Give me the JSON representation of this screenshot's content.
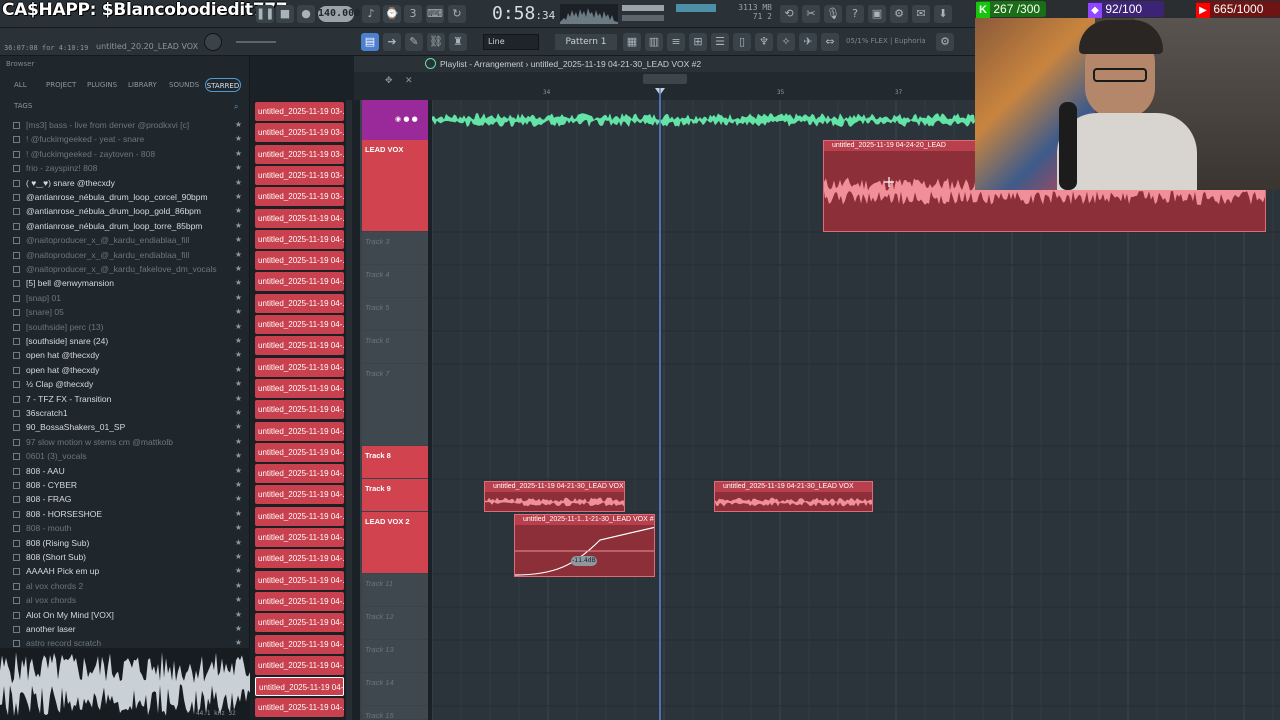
{
  "topbar": {
    "overlay_text": "CA$HAPP: $Blancobodiedit777",
    "bpm": "140.000",
    "time_main": "0:58",
    "time_sub": ":34",
    "mem_line1": "3113 MB",
    "mem_line2": "71  2",
    "elapsed": "36:07:08 for 4:10:19",
    "hint_file": "untitled_20.20_LEAD VOX",
    "line_mode": "Line",
    "pattern": "Pattern 1",
    "plugin_label": "05/1% FLEX | Euphoria"
  },
  "browser": {
    "title": "Browser",
    "tabs": [
      "ALL",
      "PROJECT",
      "PLUGINS",
      "LIBRARY",
      "SOUNDS",
      "STARRED"
    ],
    "tags_label": "TAGS",
    "items": [
      {
        "label": "[ms3] bass - live from denver @prodkxvi [c]",
        "dim": true
      },
      {
        "label": "! @fuckimgeeked - yeat - snare",
        "dim": true
      },
      {
        "label": "! @fuckimgeeked - zaytoven - 808",
        "dim": true
      },
      {
        "label": "frio - zayspinz! 808",
        "dim": true
      },
      {
        "label": "( ♥‿♥) snare @thecxdy",
        "dim": false
      },
      {
        "label": "@antianrose_nébula_drum_loop_corcel_90bpm",
        "dim": false
      },
      {
        "label": "@antianrose_nébula_drum_loop_gold_86bpm",
        "dim": false
      },
      {
        "label": "@antianrose_nébula_drum_loop_torre_85bpm",
        "dim": false
      },
      {
        "label": "@naitoproducer_x_@_kardu_endiablaa_fill",
        "dim": true
      },
      {
        "label": "@naitoproducer_x_@_kardu_endiablaa_fill",
        "dim": true
      },
      {
        "label": "@naitoproducer_x_@_kardu_fakelove_dm_vocals",
        "dim": true
      },
      {
        "label": "[5] bell @enwymansion",
        "dim": false
      },
      {
        "label": "[snap] 01",
        "dim": true
      },
      {
        "label": "[snare] 05",
        "dim": true
      },
      {
        "label": "[southside] perc (13)",
        "dim": true
      },
      {
        "label": "[southside] snare (24)",
        "dim": false
      },
      {
        "label": "open hat @thecxdy",
        "dim": false
      },
      {
        "label": "open hat @thecxdy",
        "dim": false
      },
      {
        "label": "½ Clap @thecxdy",
        "dim": false
      },
      {
        "label": "7 - TFZ FX - Transition",
        "dim": false
      },
      {
        "label": "36scratch1",
        "dim": false
      },
      {
        "label": "90_BossaShakers_01_SP",
        "dim": false
      },
      {
        "label": "97 slow motion w stems cm @mattkolb",
        "dim": true
      },
      {
        "label": "0601 (3)_vocals",
        "dim": true
      },
      {
        "label": "808 - AAU",
        "dim": false
      },
      {
        "label": "808 - CYBER",
        "dim": false
      },
      {
        "label": "808 - FRAG",
        "dim": false
      },
      {
        "label": "808 - HORSESHOE",
        "dim": false
      },
      {
        "label": "808 - mouth",
        "dim": true
      },
      {
        "label": "808 (Rising Sub)",
        "dim": false
      },
      {
        "label": "808 (Short Sub)",
        "dim": false
      },
      {
        "label": "AAAAH Pick em up",
        "dim": false
      },
      {
        "label": "al vox chords 2",
        "dim": true
      },
      {
        "label": "al vox chords",
        "dim": true
      },
      {
        "label": "Alot On My Mind [VOX]",
        "dim": false
      },
      {
        "label": "another laser",
        "dim": false
      },
      {
        "label": "astro record scratch",
        "dim": true
      }
    ],
    "sample_info": "44.1 kHz 32"
  },
  "clip_list": {
    "items": [
      "untitled_2025-11-19 03-...",
      "untitled_2025-11-19 03-...",
      "untitled_2025-11-19 03-...",
      "untitled_2025-11-19 03-...",
      "untitled_2025-11-19 03-...",
      "untitled_2025-11-19 04-...",
      "untitled_2025-11-19 04-...",
      "untitled_2025-11-19 04-...",
      "untitled_2025-11-19 04-...",
      "untitled_2025-11-19 04-...",
      "untitled_2025-11-19 04-...",
      "untitled_2025-11-19 04-...",
      "untitled_2025-11-19 04-...",
      "untitled_2025-11-19 04-...",
      "untitled_2025-11-19 04-...",
      "untitled_2025-11-19 04-...",
      "untitled_2025-11-19 04-...",
      "untitled_2025-11-19 04-...",
      "untitled_2025-11-19 04-...",
      "untitled_2025-11-19 04-...",
      "untitled_2025-11-19 04-...",
      "untitled_2025-11-19 04-...",
      "untitled_2025-11-19 04-...",
      "untitled_2025-11-19 04-...",
      "untitled_2025-11-19 04-...",
      "untitled_2025-11-19 04-...",
      "untitled_2025-11-19 04-...",
      "untitled_2025-11-19 04-...",
      "untitled_2025-11-19 04-..."
    ]
  },
  "playlist": {
    "title": "Playlist - Arrangement › untitled_2025-11-19 04-21-30_LEAD VOX #2",
    "bar_numbers": [
      "34",
      "35",
      "37"
    ],
    "tracks": [
      {
        "name": "LEAD VOX",
        "colored": true
      },
      {
        "name": "Track 3",
        "colored": false
      },
      {
        "name": "Track 4",
        "colored": false
      },
      {
        "name": "Track 5",
        "colored": false
      },
      {
        "name": "Track 6",
        "colored": false
      },
      {
        "name": "Track 7",
        "colored": false
      },
      {
        "name": "Track 8",
        "colored": true
      },
      {
        "name": "Track 9",
        "colored": true
      },
      {
        "name": "LEAD VOX 2",
        "colored": true
      },
      {
        "name": "Track 11",
        "colored": false
      },
      {
        "name": "Track 12",
        "colored": false
      },
      {
        "name": "Track 13",
        "colored": false
      },
      {
        "name": "Track 14",
        "colored": false
      },
      {
        "name": "Track 15",
        "colored": false
      }
    ],
    "clips": {
      "lead_vox": "untitled_2025-11-19 04-24-20_LEAD",
      "track9_a": "untitled_2025-11-19 04-21-30_LEAD VOX",
      "track9_b": "untitled_2025-11-19 04-21-30_LEAD VOX",
      "lead_vox2": "untitled_2025-11-1..1-21-30_LEAD VOX #4"
    },
    "volume_badge": "-11.4dB"
  },
  "stream": {
    "stat1": "267 /300",
    "stat2": "92/100",
    "stat3": "665/1000",
    "colors": {
      "stat1": "#16c60c",
      "stat2": "#9146ff",
      "stat3": "#ff0000"
    }
  },
  "colors": {
    "accent": "#d1444f",
    "clip_fill": "#8c2f39",
    "waveform_green": "#63e3a6"
  }
}
